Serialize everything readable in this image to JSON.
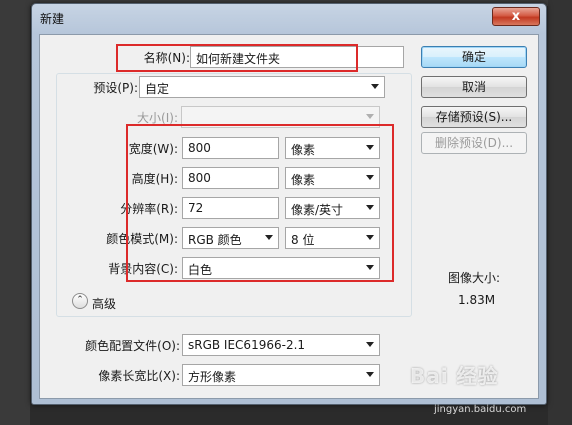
{
  "window": {
    "title": "新建",
    "close_glyph": "x"
  },
  "form": {
    "name": {
      "label": "名称(N):",
      "value": "如何新建文件夹"
    },
    "preset": {
      "label": "预设(P):",
      "value": "自定"
    },
    "size": {
      "label": "大小(I):",
      "value": ""
    },
    "width": {
      "label": "宽度(W):",
      "value": "800",
      "unit": "像素"
    },
    "height": {
      "label": "高度(H):",
      "value": "800",
      "unit": "像素"
    },
    "resolution": {
      "label": "分辨率(R):",
      "value": "72",
      "unit": "像素/英寸"
    },
    "color_mode": {
      "label": "颜色模式(M):",
      "value": "RGB 颜色",
      "bits": "8 位"
    },
    "background": {
      "label": "背景内容(C):",
      "value": "白色"
    },
    "advanced": {
      "label": "高级",
      "expander_glyph": "⌃"
    },
    "color_profile": {
      "label": "颜色配置文件(O):",
      "value": "sRGB IEC61966-2.1"
    },
    "pixel_aspect": {
      "label": "像素长宽比(X):",
      "value": "方形像素"
    }
  },
  "buttons": {
    "ok": "确定",
    "cancel": "取消",
    "save_preset": "存储预设(S)...",
    "delete_preset": "删除预设(D)..."
  },
  "image_size": {
    "label": "图像大小:",
    "value": "1.83M"
  },
  "watermark": {
    "brand": "Bai 经验",
    "url": "jingyan.baidu.com"
  },
  "colors": {
    "highlight": "#dc2a2a",
    "window_frame": "#b6c6da",
    "client": "#f0f0f0"
  }
}
